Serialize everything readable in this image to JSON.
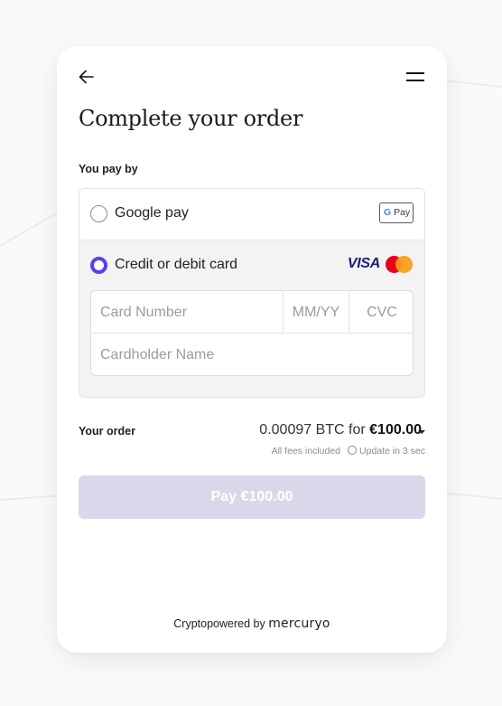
{
  "header": {
    "title": "Complete your order"
  },
  "payment": {
    "label": "You pay by",
    "methods": [
      {
        "label": "Google pay",
        "selected": false,
        "badge": "Pay"
      },
      {
        "label": "Credit or debit card",
        "selected": true,
        "brand_visa": "VISA"
      }
    ],
    "card_form": {
      "number_placeholder": "Card Number",
      "expiry_placeholder": "MM/YY",
      "cvc_placeholder": "CVC",
      "name_placeholder": "Cardholder Name"
    }
  },
  "order": {
    "label": "Your order",
    "amount_crypto": "0.00097 BTC for",
    "amount_fiat": "€100.00",
    "fees_note": "All fees included",
    "update_note": "Update in 3 sec"
  },
  "pay_button": {
    "label": "Pay €100.00"
  },
  "footer": {
    "prefix": "Cryptopowered by",
    "brand": "mercuryo"
  },
  "colors": {
    "accent": "#5b3df5",
    "pay_button_disabled": "#dad7ea",
    "visa": "#1a1f71",
    "mastercard_red": "#eb001b",
    "mastercard_orange": "#f79e1b"
  },
  "icons": {
    "back": "arrow-left-icon",
    "menu": "hamburger-menu-icon",
    "gpay": "google-pay-icon",
    "visa": "visa-icon",
    "mastercard": "mastercard-icon",
    "dropdown": "chevron-down-icon",
    "timer": "clock-icon"
  }
}
